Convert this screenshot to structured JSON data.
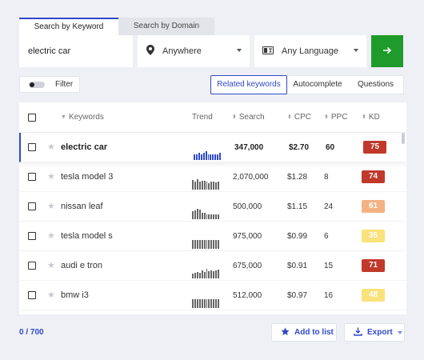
{
  "tabs": [
    {
      "label": "Search by Keyword",
      "active": true
    },
    {
      "label": "Search by Domain",
      "active": false
    }
  ],
  "search": {
    "keyword_value": "electric car",
    "location": {
      "label": "Anywhere",
      "icon": "map-pin-icon"
    },
    "language": {
      "label": "Any Language",
      "icon": "translate-icon"
    },
    "go_icon": "arrow-right-icon",
    "go_color": "#1e9b2a"
  },
  "filter": {
    "label": "Filter",
    "enabled": false
  },
  "views": [
    {
      "label": "Related keywords",
      "active": true
    },
    {
      "label": "Autocomplete",
      "active": false
    },
    {
      "label": "Questions",
      "active": false
    }
  ],
  "table": {
    "headers": {
      "keywords": "Keywords",
      "trend": "Trend",
      "search": "Search",
      "cpc": "CPC",
      "ppc": "PPC",
      "kd": "KD"
    },
    "rows": [
      {
        "keyword": "electric car",
        "search": "347,000",
        "cpc": "$2.70",
        "ppc": "60",
        "kd": "75",
        "kd_color": "#c0392b",
        "selected": true,
        "trend": [
          0.55,
          0.55,
          0.7,
          0.55,
          0.7,
          0.85,
          0.55,
          0.55,
          0.55,
          0.55,
          0.55,
          0.7
        ]
      },
      {
        "keyword": "tesla model 3",
        "search": "2,070,000",
        "cpc": "$1.28",
        "ppc": "8",
        "kd": "74",
        "kd_color": "#c0392b",
        "selected": false,
        "trend": [
          0.9,
          0.75,
          1.0,
          0.8,
          0.85,
          0.85,
          0.75,
          0.6,
          0.75,
          0.75,
          0.7,
          0.75
        ]
      },
      {
        "keyword": "nissan leaf",
        "search": "500,000",
        "cpc": "$1.15",
        "ppc": "24",
        "kd": "61",
        "kd_color": "#f4b282",
        "selected": false,
        "trend": [
          0.8,
          0.85,
          1.0,
          0.9,
          0.65,
          0.65,
          0.45,
          0.45,
          0.45,
          0.45,
          0.45,
          0.45
        ]
      },
      {
        "keyword": "tesla model s",
        "search": "975,000",
        "cpc": "$0.99",
        "ppc": "6",
        "kd": "35",
        "kd_color": "#f9e27a",
        "selected": false,
        "trend": [
          0.85,
          0.85,
          0.85,
          0.85,
          0.85,
          0.85,
          0.85,
          0.85,
          0.85,
          0.85,
          0.85,
          0.85
        ]
      },
      {
        "keyword": "audi e tron",
        "search": "675,000",
        "cpc": "$0.91",
        "ppc": "15",
        "kd": "71",
        "kd_color": "#c0392b",
        "selected": false,
        "trend": [
          0.45,
          0.5,
          0.6,
          0.5,
          0.75,
          0.6,
          0.9,
          0.7,
          0.8,
          0.7,
          0.8,
          0.85
        ]
      },
      {
        "keyword": "bmw i3",
        "search": "512,000",
        "cpc": "$0.97",
        "ppc": "16",
        "kd": "48",
        "kd_color": "#f9e27a",
        "selected": false,
        "trend": [
          0.85,
          0.85,
          0.85,
          0.85,
          0.85,
          0.85,
          0.85,
          0.85,
          0.85,
          0.85,
          0.85,
          0.85
        ]
      },
      {
        "keyword": "",
        "search": "",
        "cpc": "",
        "ppc": "",
        "kd": "",
        "kd_color": "#ffffff",
        "selected": false,
        "trend": []
      }
    ]
  },
  "footer": {
    "count": "0 / 700",
    "add_label": "Add to list",
    "export_label": "Export"
  },
  "accent": "#2f49c8"
}
